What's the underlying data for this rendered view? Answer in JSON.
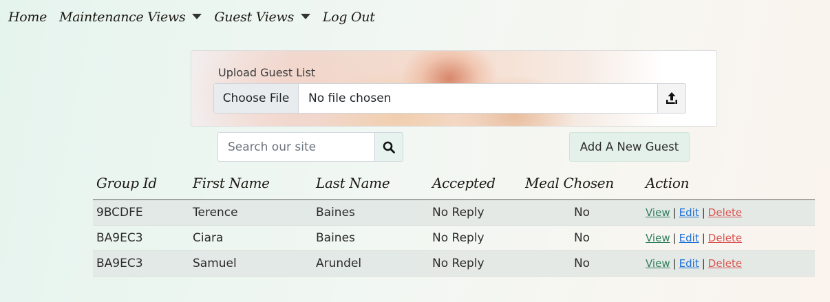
{
  "nav": {
    "items": [
      {
        "label": "Home",
        "dropdown": false
      },
      {
        "label": "Maintenance Views",
        "dropdown": true
      },
      {
        "label": "Guest Views",
        "dropdown": true
      },
      {
        "label": "Log Out",
        "dropdown": false
      }
    ]
  },
  "upload": {
    "label": "Upload Guest List",
    "choose_file": "Choose File",
    "file_status": "No file chosen",
    "upload_icon": "upload-icon"
  },
  "search": {
    "placeholder": "Search our site",
    "value": "",
    "icon": "search-icon"
  },
  "add_guest_label": "Add A New Guest",
  "table": {
    "columns": [
      "Group Id",
      "First Name",
      "Last Name",
      "Accepted",
      "Meal Chosen",
      "Action"
    ],
    "rows": [
      {
        "group_id": "9BCDFE",
        "first": "Terence",
        "last": "Baines",
        "accepted": "No Reply",
        "meal": "No"
      },
      {
        "group_id": "BA9EC3",
        "first": "Ciara",
        "last": "Baines",
        "accepted": "No Reply",
        "meal": "No"
      },
      {
        "group_id": "BA9EC3",
        "first": "Samuel",
        "last": "Arundel",
        "accepted": "No Reply",
        "meal": "No"
      }
    ],
    "actions": {
      "view": "View",
      "edit": "Edit",
      "delete": "Delete",
      "separator": "|"
    }
  },
  "colors": {
    "view": "#2e7d5b",
    "edit": "#1f6fd6",
    "delete": "#d9534f",
    "accent": "#e4f1eb"
  }
}
